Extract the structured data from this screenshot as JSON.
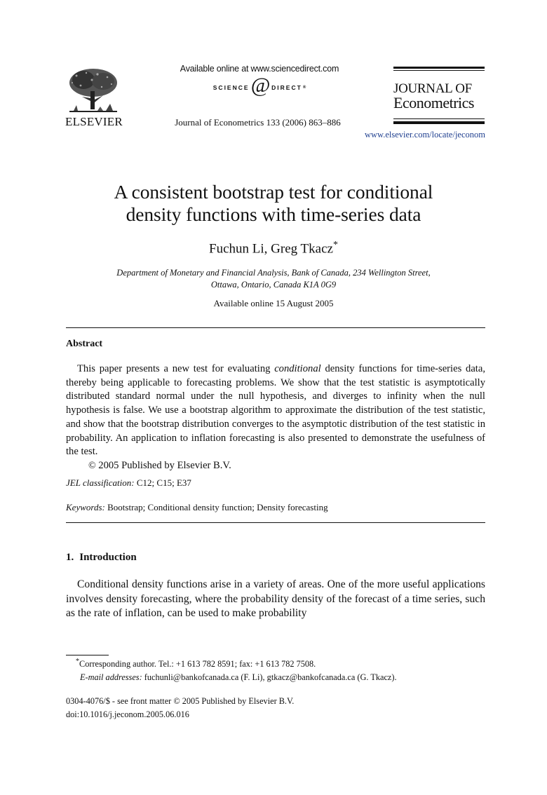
{
  "header": {
    "publisher_logo_text": "ELSEVIER",
    "sciencedirect_available": "Available online at www.sciencedirect.com",
    "sciencedirect_logo": {
      "left": "SCIENCE",
      "at": "@",
      "right": "DIRECT",
      "reg": "®"
    },
    "citation": "Journal of Econometrics 133 (2006) 863–886",
    "journal_name_line1": "JOURNAL OF",
    "journal_name_line2": "Econometrics",
    "journal_url": "www.elsevier.com/locate/jeconom"
  },
  "article": {
    "title_line1": "A consistent bootstrap test for conditional",
    "title_line2": "density functions with time-series data",
    "authors": "Fuchun Li, Greg Tkacz",
    "author_mark": "*",
    "affiliation_line1": "Department of Monetary and Financial Analysis, Bank of Canada, 234 Wellington Street,",
    "affiliation_line2": "Ottawa, Ontario, Canada K1A 0G9",
    "available_online": "Available online 15 August 2005"
  },
  "abstract": {
    "heading": "Abstract",
    "text_before_emphasis": "This paper presents a new test for evaluating ",
    "emphasis": "conditional",
    "text_after_emphasis": " density functions for time-series data, thereby being applicable to forecasting problems. We show that the test statistic is asymptotically distributed standard normal under the null hypothesis, and diverges to infinity when the null hypothesis is false. We use a bootstrap algorithm to approximate the distribution of the test statistic, and show that the bootstrap distribution converges to the asymptotic distribution of the test statistic in probability. An application to inflation forecasting is also presented to demonstrate the usefulness of the test.",
    "copyright_symbol": "©",
    "copyright": " 2005 Published by Elsevier B.V."
  },
  "classification": {
    "jel_label": "JEL classification:",
    "jel_codes": " C12; C15; E37",
    "keywords_label": "Keywords:",
    "keywords": " Bootstrap; Conditional density function; Density forecasting"
  },
  "sections": [
    {
      "number": "1.",
      "title": "Introduction",
      "text": "Conditional density functions arise in a variety of areas. One of the more useful applications involves density forecasting, where the probability density of the forecast of a time series, such as the rate of inflation, can be used to make probability"
    }
  ],
  "footnotes": {
    "mark": "*",
    "corresponding": "Corresponding author. Tel.: +1 613 782 8591; fax: +1 613 782 7508.",
    "email_label": "E-mail addresses:",
    "emails": " fuchunli@bankofcanada.ca (F. Li), gtkacz@bankofcanada.ca (G. Tkacz)."
  },
  "front_matter": {
    "issn_line_before": "0304-4076/$ - see front matter ",
    "copyright_symbol": "©",
    "issn_line_after": " 2005 Published by Elsevier B.V.",
    "doi": "doi:10.1016/j.jeconom.2005.06.016"
  }
}
